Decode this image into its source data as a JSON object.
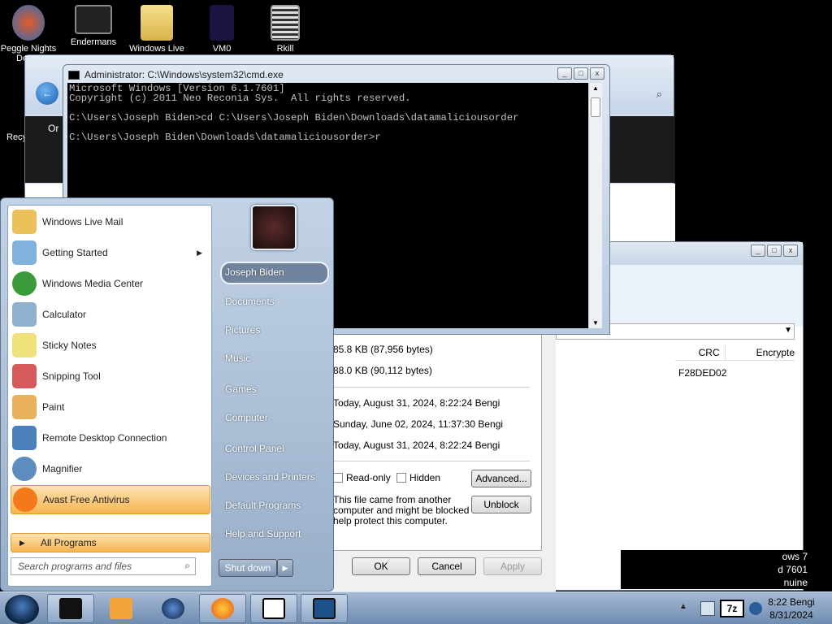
{
  "desktop": {
    "icons": [
      {
        "label": "Peggle Nights",
        "label2": "De",
        "icon": "peggle-icon"
      },
      {
        "label": "Endermans",
        "icon": "endermans-icon"
      },
      {
        "label": "Windows Live",
        "icon": "folder-icon"
      },
      {
        "label": "VM0",
        "icon": "vm-icon"
      },
      {
        "label": "Rkill",
        "icon": "rkill-icon"
      }
    ],
    "left_fragments": {
      "recycle": "Recy",
      "or": "Or"
    }
  },
  "cmd": {
    "title": "Administrator: C:\\Windows\\system32\\cmd.exe",
    "lines": [
      "Microsoft Windows [Version 6.1.7601]",
      "Copyright (c) 2011 Neo Reconia Sys.  All rights reserved.",
      "",
      "C:\\Users\\Joseph Biden>cd C:\\Users\\Joseph Biden\\Downloads\\datamaliciousorder",
      "",
      "C:\\Users\\Joseph Biden\\Downloads\\datamaliciousorder>r"
    ]
  },
  "properties": {
    "size": "85.8 KB (87,956 bytes)",
    "size_on_disk": "88.0 KB (90,112 bytes)",
    "created": "Today, August 31, 2024, 8:22:24 Bengi",
    "modified": "Sunday, June 02, 2024, 11:37:30 Bengi",
    "accessed": "Today, August 31, 2024, 8:22:24 Bengi",
    "readonly_label": "Read-only",
    "hidden_label": "Hidden",
    "advanced_label": "Advanced...",
    "security_text": [
      "This file came from another",
      "computer and might be blocked to",
      "help protect this computer."
    ],
    "unblock_label": "Unblock",
    "ok_label": "OK",
    "cancel_label": "Cancel",
    "apply_label": "Apply"
  },
  "archive": {
    "col_crc": "CRC",
    "col_encrypted": "Encrypte",
    "crc_value": "F28DED02",
    "behind_text": "...",
    "side_text": [
      "ows 7",
      "d 7601",
      "nuine"
    ]
  },
  "start_menu": {
    "programs": [
      {
        "label": "Windows Live Mail",
        "icon": "mail-icon",
        "color": "#e9c35a"
      },
      {
        "label": "Getting Started",
        "icon": "getting-started-icon",
        "color": "#7fb3dd",
        "submenu": "▶"
      },
      {
        "label": "Windows Media Center",
        "icon": "media-center-icon",
        "color": "#3b9b3b"
      },
      {
        "label": "Calculator",
        "icon": "calculator-icon",
        "color": "#8fb0cf"
      },
      {
        "label": "Sticky Notes",
        "icon": "sticky-notes-icon",
        "color": "#f0e27a"
      },
      {
        "label": "Snipping Tool",
        "icon": "scissors-icon",
        "color": "#d65a5a"
      },
      {
        "label": "Paint",
        "icon": "paint-icon",
        "color": "#e9b25a"
      },
      {
        "label": "Remote Desktop Connection",
        "icon": "remote-desktop-icon",
        "color": "#4c80bd"
      },
      {
        "label": "Magnifier",
        "icon": "magnifier-icon",
        "color": "#5d8dbf"
      },
      {
        "label": "Avast Free Antivirus",
        "icon": "avast-icon",
        "color": "#f27a1a"
      }
    ],
    "all_programs": "All Programs",
    "search_placeholder": "Search programs and files",
    "right_items": [
      "Joseph Biden",
      "Documents",
      "Pictures",
      "Music",
      "Games",
      "Computer",
      "Control Panel",
      "Devices and Printers",
      "Default Programs",
      "Help and Support"
    ],
    "shutdown_label": "Shut down"
  },
  "taskbar": {
    "clock_time": "8:22 Bengi",
    "clock_date": "8/31/2024",
    "tray_7z": "7z",
    "show_hidden": "▲"
  }
}
